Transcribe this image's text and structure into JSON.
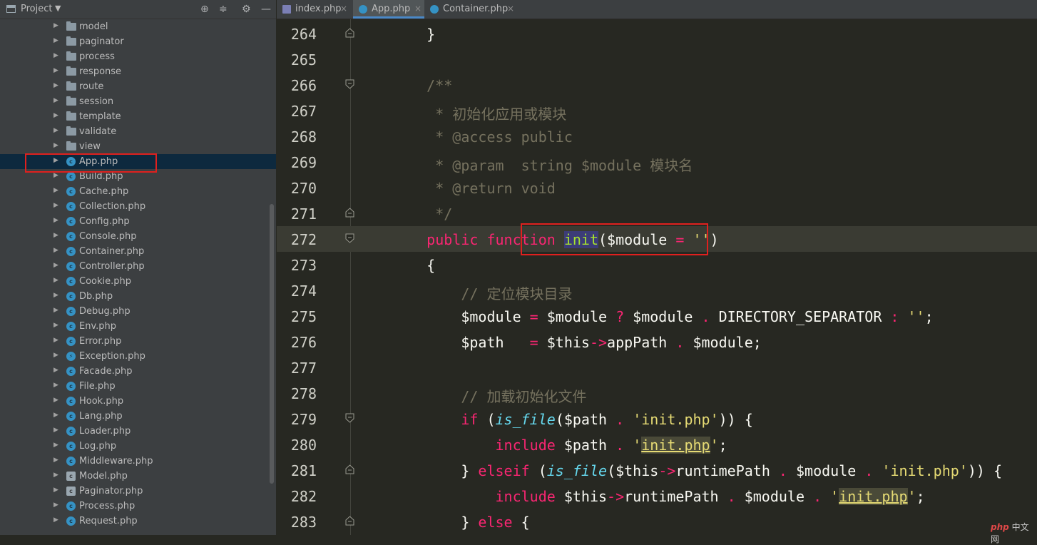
{
  "sidebar": {
    "title": "Project",
    "items": [
      {
        "label": "model",
        "type": "folder"
      },
      {
        "label": "paginator",
        "type": "folder"
      },
      {
        "label": "process",
        "type": "folder"
      },
      {
        "label": "response",
        "type": "folder"
      },
      {
        "label": "route",
        "type": "folder"
      },
      {
        "label": "session",
        "type": "folder"
      },
      {
        "label": "template",
        "type": "folder"
      },
      {
        "label": "validate",
        "type": "folder"
      },
      {
        "label": "view",
        "type": "folder"
      },
      {
        "label": "App.php",
        "type": "class",
        "selected": true
      },
      {
        "label": "Build.php",
        "type": "class"
      },
      {
        "label": "Cache.php",
        "type": "class"
      },
      {
        "label": "Collection.php",
        "type": "class"
      },
      {
        "label": "Config.php",
        "type": "class"
      },
      {
        "label": "Console.php",
        "type": "class"
      },
      {
        "label": "Container.php",
        "type": "class"
      },
      {
        "label": "Controller.php",
        "type": "class"
      },
      {
        "label": "Cookie.php",
        "type": "class"
      },
      {
        "label": "Db.php",
        "type": "class"
      },
      {
        "label": "Debug.php",
        "type": "class"
      },
      {
        "label": "Env.php",
        "type": "class"
      },
      {
        "label": "Error.php",
        "type": "class"
      },
      {
        "label": "Exception.php",
        "type": "exception"
      },
      {
        "label": "Facade.php",
        "type": "class"
      },
      {
        "label": "File.php",
        "type": "class"
      },
      {
        "label": "Hook.php",
        "type": "class"
      },
      {
        "label": "Lang.php",
        "type": "class"
      },
      {
        "label": "Loader.php",
        "type": "class"
      },
      {
        "label": "Log.php",
        "type": "class"
      },
      {
        "label": "Middleware.php",
        "type": "class"
      },
      {
        "label": "Model.php",
        "type": "abstract"
      },
      {
        "label": "Paginator.php",
        "type": "abstract"
      },
      {
        "label": "Process.php",
        "type": "class"
      },
      {
        "label": "Request.php",
        "type": "class"
      }
    ]
  },
  "tabs": [
    {
      "label": "index.php",
      "icon": "php-file-icon"
    },
    {
      "label": "App.php",
      "icon": "class-icon",
      "active": true
    },
    {
      "label": "Container.php",
      "icon": "class-icon"
    }
  ],
  "editor": {
    "current_line": "272",
    "lines": [
      {
        "num": "264",
        "html": "    }"
      },
      {
        "num": "265",
        "html": ""
      },
      {
        "num": "266",
        "html": "    <span class=\"cm\">/**</span>"
      },
      {
        "num": "267",
        "html": "<span class=\"cm\">     * 初始化应用或模块</span>"
      },
      {
        "num": "268",
        "html": "<span class=\"cm\">     * @access public</span>"
      },
      {
        "num": "269",
        "html": "<span class=\"cm\">     * @param  string $module 模块名</span>"
      },
      {
        "num": "270",
        "html": "<span class=\"cm\">     * @return void</span>"
      },
      {
        "num": "271",
        "html": "<span class=\"cm\">     */</span>"
      },
      {
        "num": "272",
        "html": "    <span class=\"kw\">public</span> <span class=\"kw\">function</span> <span class=\"cursor\"></span><span class=\"fn sel\">init</span>($module <span class=\"kw\">=</span> <span class=\"st\">''</span>)"
      },
      {
        "num": "273",
        "html": "    {"
      },
      {
        "num": "274",
        "html": "        <span class=\"cm\">// 定位模块目录</span>"
      },
      {
        "num": "275",
        "html": "        $module <span class=\"kw\">=</span> $module <span class=\"kw\">?</span> $module <span class=\"kw\">.</span> DIRECTORY_SEPARATOR <span class=\"kw\">:</span> <span class=\"st\">''</span>;"
      },
      {
        "num": "276",
        "html": "        $path   <span class=\"kw\">=</span> $this<span class=\"kw\">-&gt;</span>appPath <span class=\"kw\">.</span> $module;"
      },
      {
        "num": "277",
        "html": ""
      },
      {
        "num": "278",
        "html": "        <span class=\"cm\">// 加载初始化文件</span>"
      },
      {
        "num": "279",
        "html": "        <span class=\"kw\">if</span> (<span class=\"bi\">is_file</span>($path <span class=\"kw\">.</span> <span class=\"st\">'init.php'</span>)) {"
      },
      {
        "num": "280",
        "html": "            <span class=\"kw\">include</span> $path <span class=\"kw\">.</span> <span class=\"st\">'<span class=\"hl\">init.php</span>'</span>;"
      },
      {
        "num": "281",
        "html": "        } <span class=\"kw\">elseif</span> (<span class=\"bi\">is_file</span>($this<span class=\"kw\">-&gt;</span>runtimePath <span class=\"kw\">.</span> $module <span class=\"kw\">.</span> <span class=\"st\">'init.php'</span>)) {"
      },
      {
        "num": "282",
        "html": "            <span class=\"kw\">include</span> $this<span class=\"kw\">-&gt;</span>runtimePath <span class=\"kw\">.</span> $module <span class=\"kw\">.</span> <span class=\"st\">'<span class=\"hl\">init.php</span>'</span>;"
      },
      {
        "num": "283",
        "html": "        } <span class=\"kw\">else</span> {"
      }
    ]
  },
  "watermark": {
    "brand": "php",
    "text": "中文网"
  },
  "colors": {
    "keyword": "#f92672",
    "function": "#a6e22e",
    "string": "#e6db74",
    "comment": "#75715e",
    "builtin": "#66d9ef",
    "annotation_box": "#e0201e"
  }
}
